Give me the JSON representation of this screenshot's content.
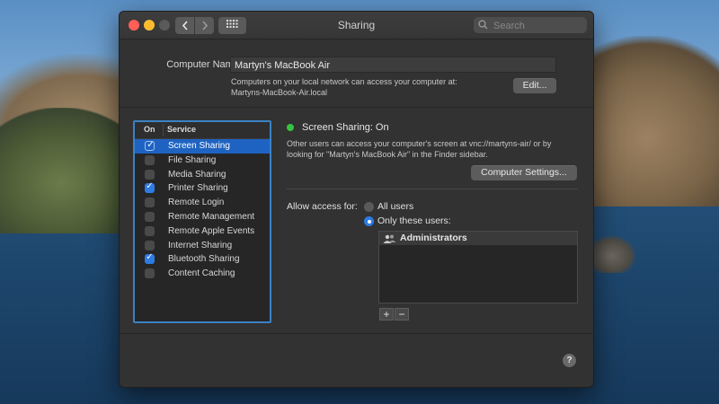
{
  "window": {
    "title": "Sharing"
  },
  "toolbar": {
    "back_icon": "chevron-left-icon",
    "forward_icon": "chevron-right-icon",
    "grid_icon": "grid-icon"
  },
  "search": {
    "placeholder": "Search"
  },
  "computer": {
    "label": "Computer Name:",
    "name": "Martyn's MacBook Air",
    "desc_line1": "Computers on your local network can access your computer at:",
    "desc_line2": "Martyns-MacBook-Air.local",
    "edit_label": "Edit..."
  },
  "services": {
    "header_on": "On",
    "header_service": "Service",
    "items": [
      {
        "label": "Screen Sharing",
        "on": true,
        "selected": true
      },
      {
        "label": "File Sharing",
        "on": false,
        "selected": false
      },
      {
        "label": "Media Sharing",
        "on": false,
        "selected": false
      },
      {
        "label": "Printer Sharing",
        "on": true,
        "selected": false
      },
      {
        "label": "Remote Login",
        "on": false,
        "selected": false
      },
      {
        "label": "Remote Management",
        "on": false,
        "selected": false
      },
      {
        "label": "Remote Apple Events",
        "on": false,
        "selected": false
      },
      {
        "label": "Internet Sharing",
        "on": false,
        "selected": false
      },
      {
        "label": "Bluetooth Sharing",
        "on": true,
        "selected": false
      },
      {
        "label": "Content Caching",
        "on": false,
        "selected": false
      }
    ]
  },
  "detail": {
    "status": "Screen Sharing: On",
    "status_color": "#37c341",
    "desc_line1": "Other users can access your computer's screen at vnc://martyns-air/ or by",
    "desc_line2": "looking for \"Martyn's MacBook Air\" in the Finder sidebar.",
    "settings_label": "Computer Settings...",
    "allow_label": "Allow access for:",
    "all_users_label": "All users",
    "only_users_label": "Only these users:",
    "selected_access": "only",
    "users": [
      {
        "label": "Administrators",
        "icon": "group-icon"
      }
    ],
    "add_label": "+",
    "remove_label": "−"
  },
  "help_label": "?",
  "accent_color": "#1f63c2"
}
